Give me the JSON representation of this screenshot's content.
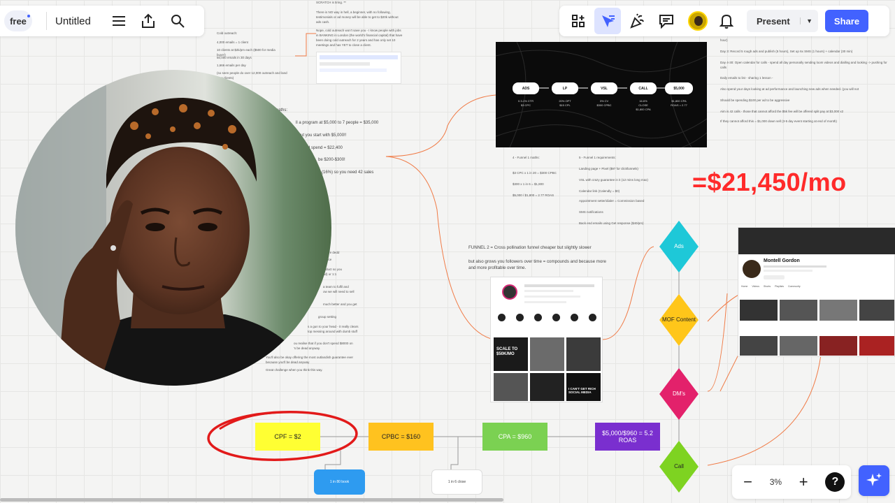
{
  "app": {
    "plan_badge": "free",
    "board_title": "Untitled",
    "zoom_level": "3%",
    "present_label": "Present",
    "share_label": "Share",
    "help_label": "?"
  },
  "colors": {
    "accent": "#4262ff",
    "revenue": "#ff2a2a",
    "ads": "#1ec8d8",
    "mof": "#ffc61a",
    "dms": "#e3216b",
    "call": "#7ed321",
    "cpf": "#ffff33",
    "cpbc": "#ffc21f",
    "cpa": "#7bd152",
    "roas": "#7a2fcf"
  },
  "notes_top_center": {
    "line1": "SCRATCH is tiring. **",
    "line2": "There is NO way in hell, a beginner, with no following, testimonials or ad money will be able to get to $20k without ads cash.",
    "line3": "Nope, cold outreach won't save you - I know people with jobs in BANKING in London (the world's financial capital) that have been doing cold outreach for 2 years and has only set 10 meetings and has YET to close a client."
  },
  "notes_left": {
    "n1": "Cold outreach:",
    "n2": "4,000 emails = 1 client",
    "n3": "10 clients at $2k/pm each ($500 for media buyer)",
    "n4": "50,000 emails in 30 days",
    "n5": "1,666 emails per day",
    "n6": "(so seen people do over 12,000 outreach and land zero clients)"
  },
  "notes_math": {
    "title": "maths:",
    "l1": "ll a program at $5,000 to 7 people = $35,000",
    "l2": "But you start with $5,000!!",
    "l3": "d spend = $22,400",
    "l4": "be $200-$300!",
    "l5": "(16%) so you need 42 sales"
  },
  "notes_left_lower": {
    "a": "you're dedd",
    "b": "dence",
    "c": "roduct so you",
    "d": "ad) or 1:1",
    "e": "a team to fulfil and",
    "f": "ow we will need to sell",
    "g": "much better and you get",
    "h": "group setting",
    "i": "s a gun to your head - it really clears",
    "j": "top messing around with dumb stuff",
    "k": "ou realise that if you don't spend $8000 on",
    "l": "'s be dead anyway.",
    "m": "You'll also be okay offering the most outlandish guarantee ever because you'll be dead anyway",
    "n": "Great challenge when you think this way."
  },
  "funnel": {
    "steps": [
      "ADS",
      "LP",
      "VSL",
      "CALL",
      "$5,000"
    ],
    "stats": [
      "0.3-1% CTR\n$3 CPC",
      "20% OPT\n$15 CPL",
      "3% CV\n$300 CPBC",
      "16.6%\nCLOSE\n$1,800 CPA",
      "$1,800 CPA\nROAS = 2.77"
    ]
  },
  "funnel1_math": {
    "title": "4 - Funnel 1 maths:",
    "l1": "$3 CPC x 1 in 20 = $300 CPBC",
    "l2": "$300 x 1 in 6 = $1,800",
    "l3": "$5,000 / $1,800 = 2.77 ROAS"
  },
  "funnel1_req": {
    "title": "5 - Funnel 1 requirements:",
    "items": [
      "Landing page + Pixel ($97 for clickfunnels)",
      "VSL with crazy guarantee in it (12 mins long max)",
      "Calendar link (Calendly = $0)",
      "Appointment setter/dialer = Commission based",
      "SMS notifications",
      "Back end emails using Get response ($40/pm)"
    ]
  },
  "right_notes": [
    "hour)",
    "Day 3: Record 5 rough ads and publish (5 hours), Set up 6x SMS (1 hours) + calendar (30 min)",
    "Day 4-30: Open calendar for calls - spend all day personally sending loom videos and dialling and looking -> pushing for calls",
    "Daily emails to list - sharing 1 lesson -",
    "Also spend your days looking at ad performance and launching new ads when needed. (you will not",
    "Should be spending $100 per ad to be aggressive",
    "Aim is 42 calls - those that cannot afford the $5k fee will be offered split pay at $3,000 x2",
    "If they cannot afford this = $1,000 down sell (3-5 day event starting at end of month)"
  ],
  "revenue": "=$21,450/mo",
  "funnel2": {
    "l1": "FUNNEL 2 = Cross pollination funnel cheaper but slightly slower",
    "l2": "but also grows you followers over time = compounds and because more and more profitable over time."
  },
  "ig_thumbs": {
    "t1": "SCALE TO $50K/MO",
    "t2": "I CAN'T GET RICH SOCIAL MEDIA"
  },
  "youtube": {
    "channel_name": "Montell Gordon",
    "tabs": [
      "Home",
      "Videos",
      "Shorts",
      "Playlists",
      "Community"
    ]
  },
  "flow": {
    "ads": "Ads",
    "mof": "MOF Content",
    "dms": "DM's",
    "call": "Call"
  },
  "metrics": {
    "cpf": "CPF = $2",
    "cpbc": "CPBC = $160",
    "cpa": "CPA = $960",
    "roas": "$5,000/$960 = 5.2 ROAS",
    "note_book": "1 in 80 book",
    "note_close": "1 in 6 close"
  }
}
